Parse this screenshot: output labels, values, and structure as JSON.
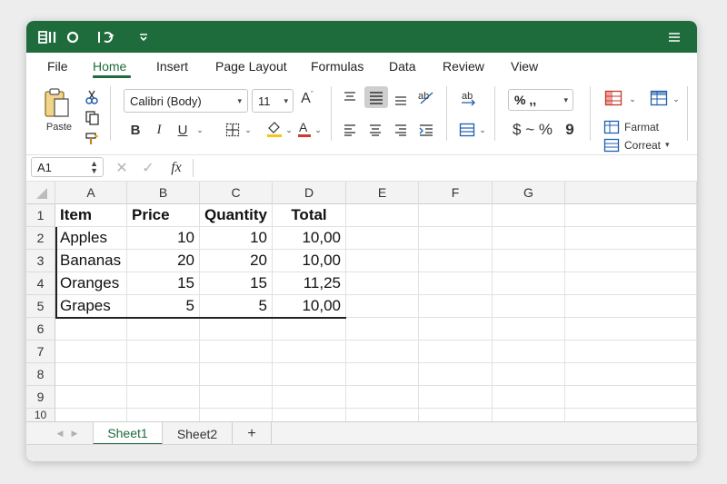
{
  "title_bar": {
    "icons": [
      "grid-logo-icon",
      "circle-icon",
      "undo-icon",
      "chevron-down-icon",
      "hamburger-menu-icon"
    ]
  },
  "menu": {
    "items": [
      "File",
      "Home",
      "Insert",
      "Page Layout",
      "Formulas",
      "Data",
      "Review",
      "View"
    ],
    "active": "Home"
  },
  "ribbon": {
    "paste_label": "Paste",
    "font_name": "Calibri (Body)",
    "font_size": "11",
    "bold": "B",
    "italic": "I",
    "underline": "U",
    "number_symbols": "% ,,",
    "currency_symbols": "$ ~ %",
    "comma_symbol": "9",
    "format_label": "Farmat",
    "correct_label": "Correat",
    "font_color": "#d03a2a",
    "fill_color": "#f5c518"
  },
  "formula_bar": {
    "name_box": "A1",
    "fx": "fx",
    "content": ""
  },
  "sheet": {
    "columns": [
      "A",
      "B",
      "C",
      "D",
      "E",
      "F",
      "G"
    ],
    "rows": [
      "1",
      "2",
      "3",
      "4",
      "5",
      "6",
      "7",
      "8",
      "9",
      "10"
    ],
    "headers": [
      "Item",
      "Price",
      "Quantity",
      "Total"
    ],
    "data": [
      [
        "Apples",
        "10",
        "10",
        "10,00"
      ],
      [
        "Bananas",
        "20",
        "20",
        "10,00"
      ],
      [
        "Oranges",
        "15",
        "15",
        "11,25"
      ],
      [
        "Grapes",
        "5",
        "5",
        "10,00"
      ]
    ]
  },
  "tabs": {
    "sheets": [
      "Sheet1",
      "Sheet2"
    ],
    "add": "+",
    "active": "Sheet1",
    "accent": "#1e6b3c"
  }
}
